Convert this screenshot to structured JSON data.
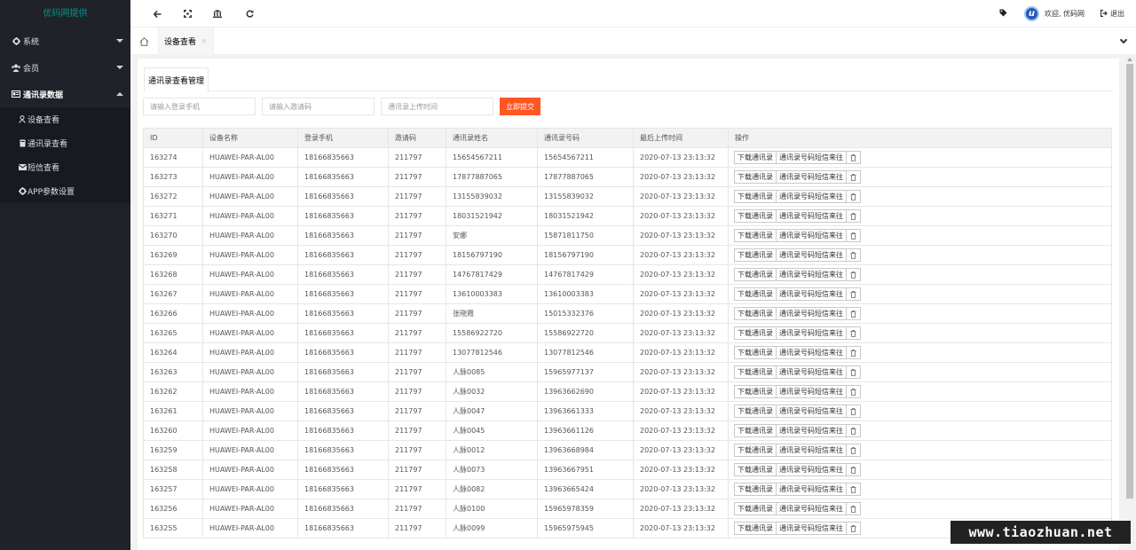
{
  "sidebar": {
    "logo": "优码网提供",
    "items": [
      {
        "icon": "gear-icon",
        "label": "系统"
      },
      {
        "icon": "users-icon",
        "label": "会员"
      },
      {
        "icon": "id-card-icon",
        "label": "通讯录数据"
      }
    ],
    "sub_items": [
      {
        "icon": "user-icon",
        "label": "设备查看"
      },
      {
        "icon": "book-icon",
        "label": "通讯录查看"
      },
      {
        "icon": "envelope-icon",
        "label": "短信查看"
      },
      {
        "icon": "gear-icon",
        "label": "APP参数设置"
      }
    ]
  },
  "header": {
    "icons": [
      "arrow-left-icon",
      "expand-icon",
      "bank-icon",
      "refresh-icon",
      "tag-icon"
    ],
    "avatar_letter": "u",
    "welcome": "欢迎, 优码网",
    "logout": "退出"
  },
  "tabs": {
    "current": "设备查看",
    "close": "×"
  },
  "content": {
    "subtab": "通讯录查看管理",
    "search": {
      "login_phone_placeholder": "请输入登录手机",
      "invite_code_placeholder": "请输入邀请码",
      "upload_time_placeholder": "通讯录上传时间",
      "submit": "立即提交"
    },
    "table": {
      "headers": [
        "ID",
        "设备名称",
        "登录手机",
        "邀请码",
        "通讯录姓名",
        "通讯录号码",
        "最后上传时间",
        "操作"
      ],
      "actions": [
        "下载通讯录",
        "通讯录号码短信来往"
      ],
      "rows": [
        [
          "163274",
          "HUAWEI-PAR-AL00",
          "18166835663",
          "211797",
          "15654567211",
          "15654567211",
          "2020-07-13 23:13:32"
        ],
        [
          "163273",
          "HUAWEI-PAR-AL00",
          "18166835663",
          "211797",
          "17877887065",
          "17877887065",
          "2020-07-13 23:13:32"
        ],
        [
          "163272",
          "HUAWEI-PAR-AL00",
          "18166835663",
          "211797",
          "13155839032",
          "13155839032",
          "2020-07-13 23:13:32"
        ],
        [
          "163271",
          "HUAWEI-PAR-AL00",
          "18166835663",
          "211797",
          "18031521942",
          "18031521942",
          "2020-07-13 23:13:32"
        ],
        [
          "163270",
          "HUAWEI-PAR-AL00",
          "18166835663",
          "211797",
          "安娜",
          "15871811750",
          "2020-07-13 23:13:32"
        ],
        [
          "163269",
          "HUAWEI-PAR-AL00",
          "18166835663",
          "211797",
          "18156797190",
          "18156797190",
          "2020-07-13 23:13:32"
        ],
        [
          "163268",
          "HUAWEI-PAR-AL00",
          "18166835663",
          "211797",
          "14767817429",
          "14767817429",
          "2020-07-13 23:13:32"
        ],
        [
          "163267",
          "HUAWEI-PAR-AL00",
          "18166835663",
          "211797",
          "13610003383",
          "13610003383",
          "2020-07-13 23:13:32"
        ],
        [
          "163266",
          "HUAWEI-PAR-AL00",
          "18166835663",
          "211797",
          "张晓霞",
          "15015332376",
          "2020-07-13 23:13:32"
        ],
        [
          "163265",
          "HUAWEI-PAR-AL00",
          "18166835663",
          "211797",
          "15586922720",
          "15586922720",
          "2020-07-13 23:13:32"
        ],
        [
          "163264",
          "HUAWEI-PAR-AL00",
          "18166835663",
          "211797",
          "13077812546",
          "13077812546",
          "2020-07-13 23:13:32"
        ],
        [
          "163263",
          "HUAWEI-PAR-AL00",
          "18166835663",
          "211797",
          "人脉0085",
          "15965977137",
          "2020-07-13 23:13:32"
        ],
        [
          "163262",
          "HUAWEI-PAR-AL00",
          "18166835663",
          "211797",
          "人脉0032",
          "13963662690",
          "2020-07-13 23:13:32"
        ],
        [
          "163261",
          "HUAWEI-PAR-AL00",
          "18166835663",
          "211797",
          "人脉0047",
          "13963661333",
          "2020-07-13 23:13:32"
        ],
        [
          "163260",
          "HUAWEI-PAR-AL00",
          "18166835663",
          "211797",
          "人脉0045",
          "13963661126",
          "2020-07-13 23:13:32"
        ],
        [
          "163259",
          "HUAWEI-PAR-AL00",
          "18166835663",
          "211797",
          "人脉0012",
          "13963668984",
          "2020-07-13 23:13:32"
        ],
        [
          "163258",
          "HUAWEI-PAR-AL00",
          "18166835663",
          "211797",
          "人脉0073",
          "13963667951",
          "2020-07-13 23:13:32"
        ],
        [
          "163257",
          "HUAWEI-PAR-AL00",
          "18166835663",
          "211797",
          "人脉0082",
          "13963665424",
          "2020-07-13 23:13:32"
        ],
        [
          "163256",
          "HUAWEI-PAR-AL00",
          "18166835663",
          "211797",
          "人脉0100",
          "15965978359",
          "2020-07-13 23:13:32"
        ],
        [
          "163255",
          "HUAWEI-PAR-AL00",
          "18166835663",
          "211797",
          "人脉0099",
          "15965975945",
          "2020-07-13 23:13:32"
        ]
      ]
    }
  },
  "watermark": "www.tiaozhuan.net",
  "colors": {
    "sidebar_bg": "#20222a",
    "submenu_bg": "#181a21",
    "logo": "#009688",
    "submit": "#ff5722"
  }
}
